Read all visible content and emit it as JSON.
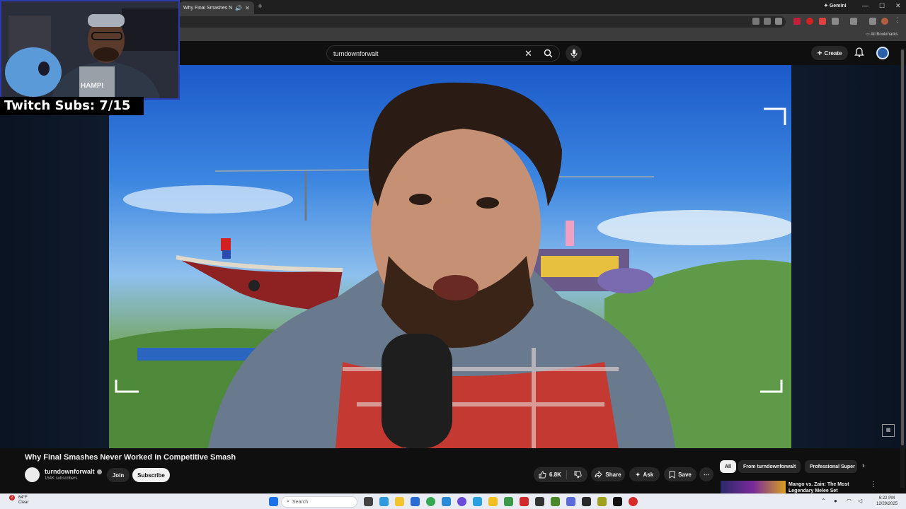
{
  "browser": {
    "tab_title": "Why Final Smashes Never W",
    "gemini_label": "Gemini",
    "all_bookmarks_label": "All Bookmarks"
  },
  "youtube": {
    "search": {
      "query": "turndownforwalt"
    },
    "create_label": "Create"
  },
  "overlay": {
    "subs_text": "Twitch Subs: 7/15"
  },
  "video": {
    "title": "Why Final Smashes Never Worked In Competitive Smash",
    "channel_name": "turndownforwalt",
    "channel_subs": "154K subscribers",
    "join_label": "Join",
    "subscribe_label": "Subscribe",
    "like_count": "6.8K",
    "share_label": "Share",
    "ask_label": "Ask",
    "save_label": "Save"
  },
  "sidebar": {
    "chips": [
      "All",
      "From turndownforwalt",
      "Professional Super"
    ],
    "recommendation_title": "Mango vs. Zain: The Most Legendary Melee Set"
  },
  "taskbar": {
    "weather_temp": "64°F",
    "weather_cond": "Clear",
    "weather_badge": "2",
    "search_placeholder": "Search",
    "time": "6:22 PM",
    "date": "12/29/2025"
  },
  "colors": {
    "yt_bg": "#0f0f0f",
    "pill_bg": "#272727",
    "subscribe_bg": "#f1f1f1",
    "webcam_border": "#2c3bb0"
  }
}
